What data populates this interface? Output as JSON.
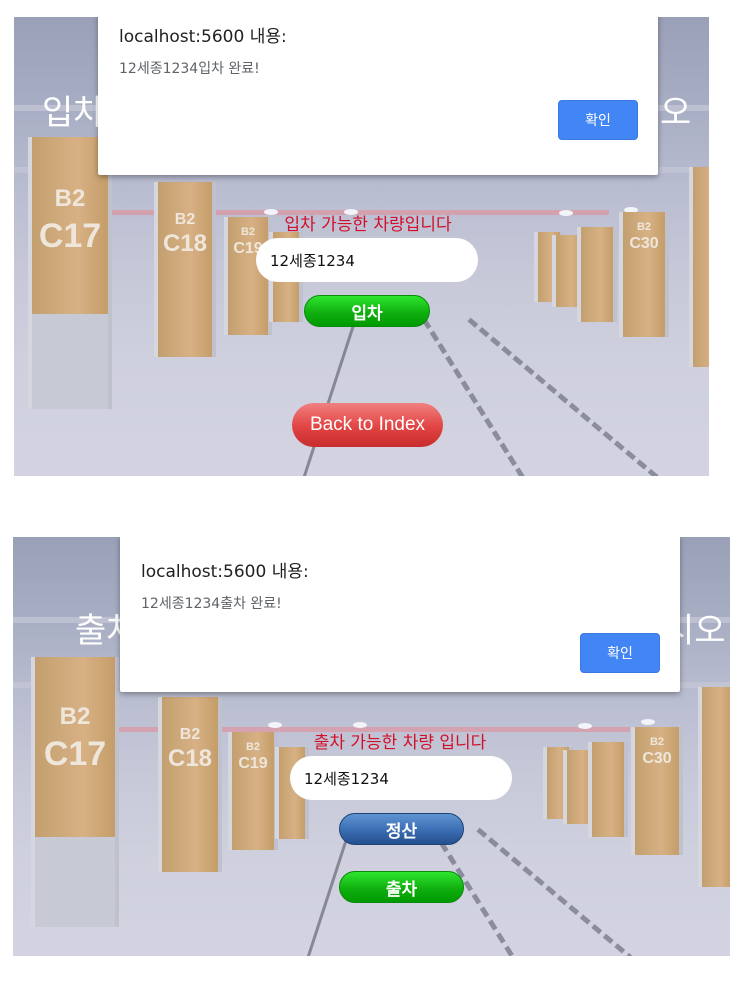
{
  "entry": {
    "title_left": "입차",
    "title_right": "오",
    "status": "입차 가능한 차량입니다",
    "plate_value": "12세종1234",
    "entry_button": "입차",
    "back_button": "Back to Index",
    "dialog": {
      "origin": "localhost:5600 내용:",
      "message": "12세종1234입차 완료!",
      "ok": "확인"
    }
  },
  "exit": {
    "title_left": "출차",
    "title_right": "시오",
    "status": "출차 가능한 차량 입니다",
    "plate_value": "12세종1234",
    "pay_button": "정산",
    "exit_button": "출차",
    "dialog": {
      "origin": "localhost:5600 내용:",
      "message": "12세종1234출차 완료!",
      "ok": "확인"
    }
  },
  "pillar_labels": {
    "floor": "B2",
    "a": "C17",
    "b": "C18",
    "c": "C19",
    "d": "C30"
  },
  "colors": {
    "status_red": "#d3102a",
    "button_green": "#10b010",
    "button_blue": "#3a6db2",
    "button_red": "#e24343",
    "dialog_button": "#4285f4"
  }
}
